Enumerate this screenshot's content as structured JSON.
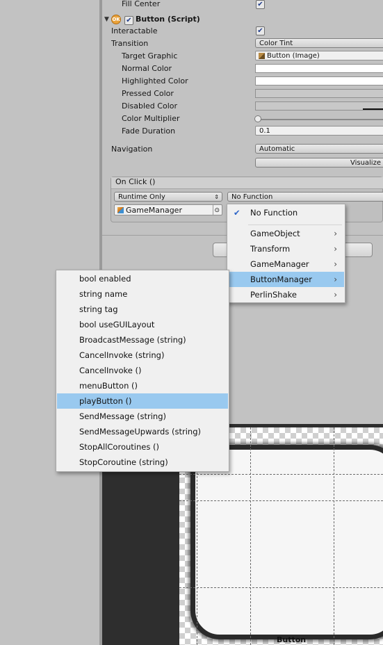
{
  "inspector": {
    "fill_center": "Fill Center",
    "component_title": "Button (Script)",
    "interactable": "Interactable",
    "transition": "Transition",
    "transition_value": "Color Tint",
    "target_graphic": "Target Graphic",
    "target_graphic_value": "Button (Image)",
    "normal_color": "Normal Color",
    "highlighted_color": "Highlighted Color",
    "pressed_color": "Pressed Color",
    "disabled_color": "Disabled Color",
    "color_multiplier": "Color Multiplier",
    "fade_duration": "Fade Duration",
    "fade_duration_value": "0.1",
    "navigation": "Navigation",
    "navigation_value": "Automatic",
    "visualize": "Visualize",
    "on_click": "On Click ()",
    "runtime_only": "Runtime Only",
    "no_function": "No Function",
    "object_field": "GameManager"
  },
  "menu1": {
    "items": [
      "No Function",
      "GameObject",
      "Transform",
      "GameManager",
      "ButtonManager",
      "PerlinShake"
    ],
    "selected": "ButtonManager"
  },
  "menu2": {
    "items": [
      "bool enabled",
      "string name",
      "string tag",
      "bool useGUILayout",
      "BroadcastMessage (string)",
      "CancelInvoke (string)",
      "CancelInvoke ()",
      "menuButton ()",
      "playButton ()",
      "SendMessage (string)",
      "SendMessageUpwards (string)",
      "StopAllCoroutines ()",
      "StopCoroutine (string)"
    ],
    "selected": "playButton ()"
  },
  "scene": {
    "sprite_label": "Button"
  },
  "colors": {
    "highlight": "#99c9ef",
    "panel": "#c2c2c2"
  }
}
